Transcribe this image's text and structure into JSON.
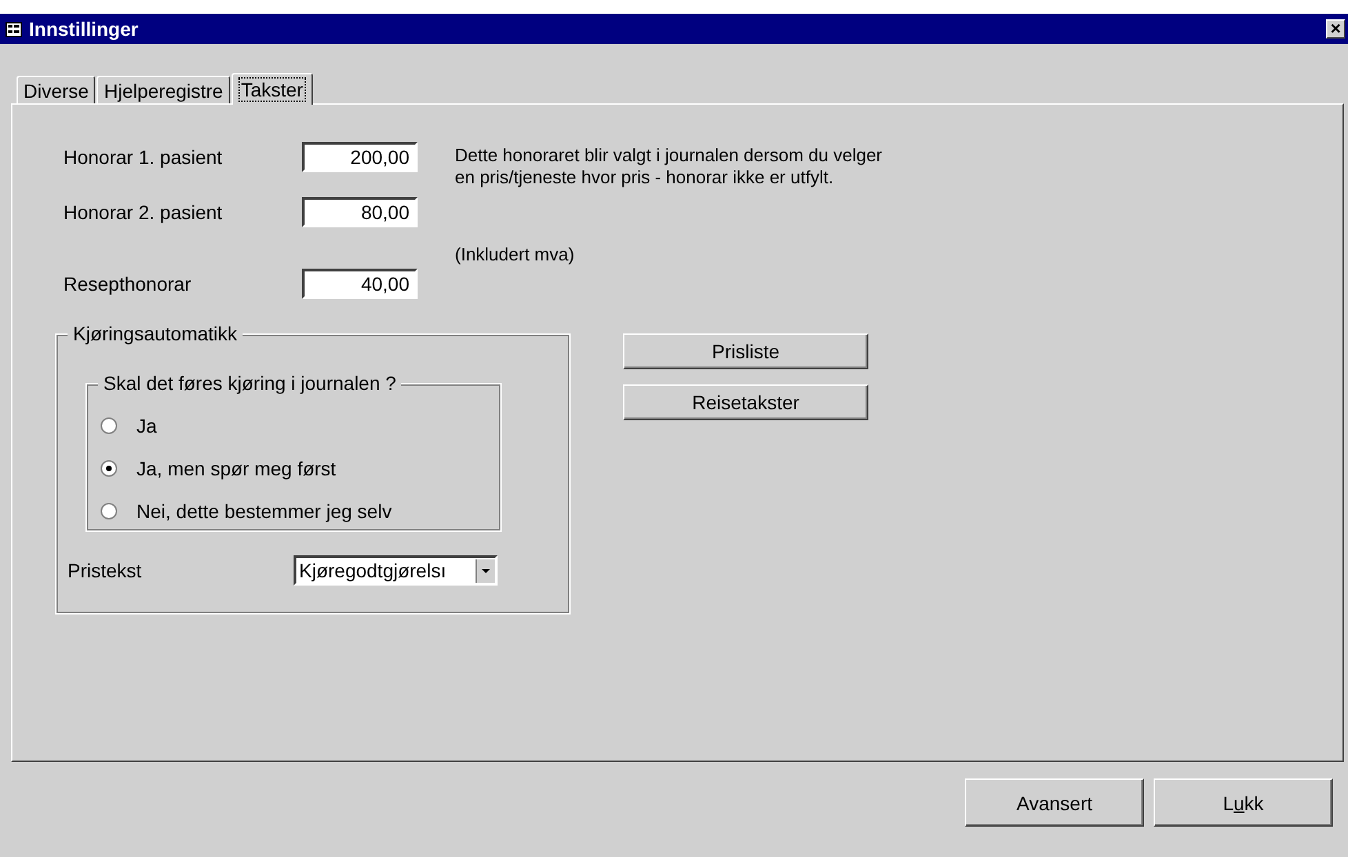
{
  "window": {
    "title": "Innstillinger",
    "close": "×"
  },
  "tabs": [
    {
      "label": "Diverse",
      "selected": false
    },
    {
      "label": "Hjelperegistre",
      "selected": false
    },
    {
      "label": "Takster",
      "selected": true
    }
  ],
  "fees": [
    {
      "label": "Honorar 1. pasient",
      "value": "200,00"
    },
    {
      "label": "Honorar 2. pasient",
      "value": "80,00"
    },
    {
      "label": "Resepthonorar",
      "value": "40,00"
    }
  ],
  "fee_note": "Dette honoraret blir valgt i journalen dersom du velger en pris/tjeneste hvor pris - honorar ikke er utfylt.",
  "vat_note": "(Inkludert mva)",
  "driving": {
    "title": "Kjøringsautomatikk",
    "question": "Skal det føres kjøring i journalen ?",
    "options": [
      {
        "label": "Ja",
        "selected": false
      },
      {
        "label": "Ja, men spør meg først",
        "selected": true
      },
      {
        "label": "Nei, dette bestemmer jeg  selv",
        "selected": false
      }
    ],
    "price_text_label": "Pristekst",
    "price_text_value": "Kjøregodtgjørelsı"
  },
  "side_buttons": [
    "Prisliste",
    "Reisetakster"
  ],
  "footer_buttons": [
    {
      "label": "Avansert"
    },
    {
      "label_before": "L",
      "mnemonic": "u",
      "label_after": "kk"
    }
  ]
}
